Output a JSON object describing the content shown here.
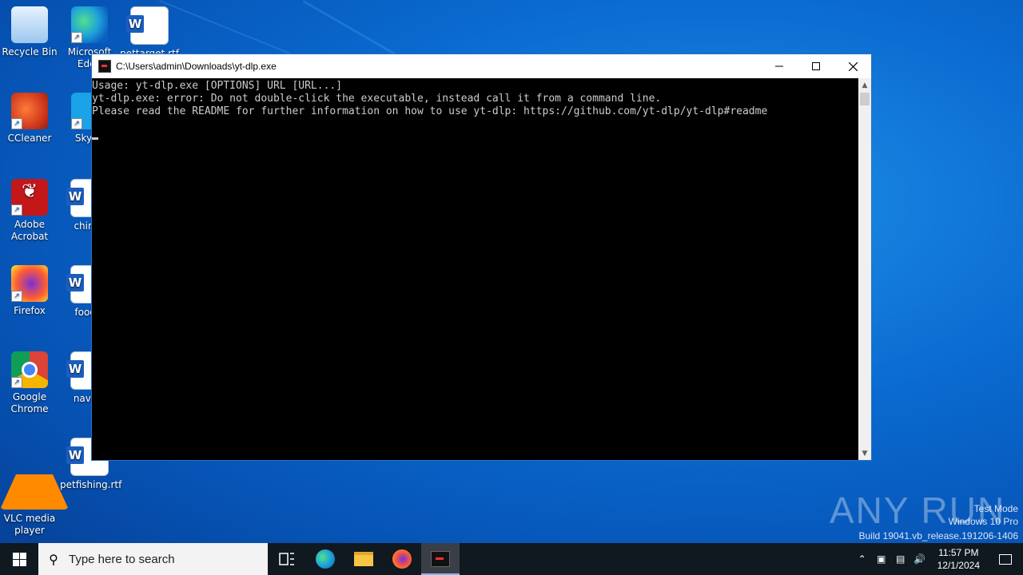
{
  "desktop": {
    "icons": [
      {
        "label": "Recycle Bin"
      },
      {
        "label": "Microsoft Edge"
      },
      {
        "label": "pettarget.rtf"
      },
      {
        "label": "CCleaner"
      },
      {
        "label": "Skype"
      },
      {
        "label": "Adobe Acrobat"
      },
      {
        "label": "chinac"
      },
      {
        "label": "Firefox"
      },
      {
        "label": "foodal"
      },
      {
        "label": "Google Chrome"
      },
      {
        "label": "naviga"
      },
      {
        "label": "VLC media player"
      },
      {
        "label": "petfishing.rtf"
      }
    ]
  },
  "console_window": {
    "title": "C:\\Users\\admin\\Downloads\\yt-dlp.exe",
    "lines": [
      "Usage: yt-dlp.exe [OPTIONS] URL [URL...]",
      "",
      "yt-dlp.exe: error: Do not double-click the executable, instead call it from a command line.",
      "Please read the README for further information on how to use yt-dlp: https://github.com/yt-dlp/yt-dlp#readme"
    ],
    "minimize_icon": "minimize-icon",
    "maximize_icon": "maximize-icon",
    "close_icon": "close-icon"
  },
  "watermark": {
    "brand": "ANY RUN",
    "mode": "Test Mode",
    "edition": "Windows 10 Pro",
    "build": "Build 19041.vb_release.191206-1406"
  },
  "taskbar": {
    "search_placeholder": "Type here to search",
    "apps": [
      "task-view",
      "edge",
      "file-explorer",
      "firefox",
      "yt-dlp-console"
    ],
    "time": "11:57 PM",
    "date": "12/1/2024"
  }
}
